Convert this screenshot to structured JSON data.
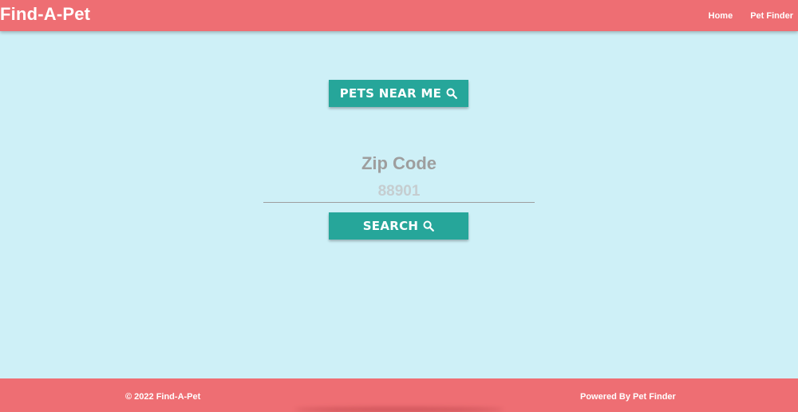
{
  "colors": {
    "navbar": "#ee6e73",
    "background": "#cef0f7",
    "button": "#26a69a",
    "footer": "#ee6e73"
  },
  "navbar": {
    "brand": "Find-A-Pet",
    "links": [
      {
        "label": "Home"
      },
      {
        "label": "Pet Finder"
      }
    ]
  },
  "main": {
    "pets_near_me_button": {
      "label": "PETS NEAR ME",
      "icon": "search-icon"
    },
    "zip_label": "Zip Code",
    "zip_input": {
      "value": "",
      "placeholder": "88901"
    },
    "search_button": {
      "label": "SEARCH",
      "icon": "search-icon"
    }
  },
  "footer": {
    "copyright": "© 2022 Find-A-Pet",
    "powered_by": "Powered By Pet Finder"
  }
}
